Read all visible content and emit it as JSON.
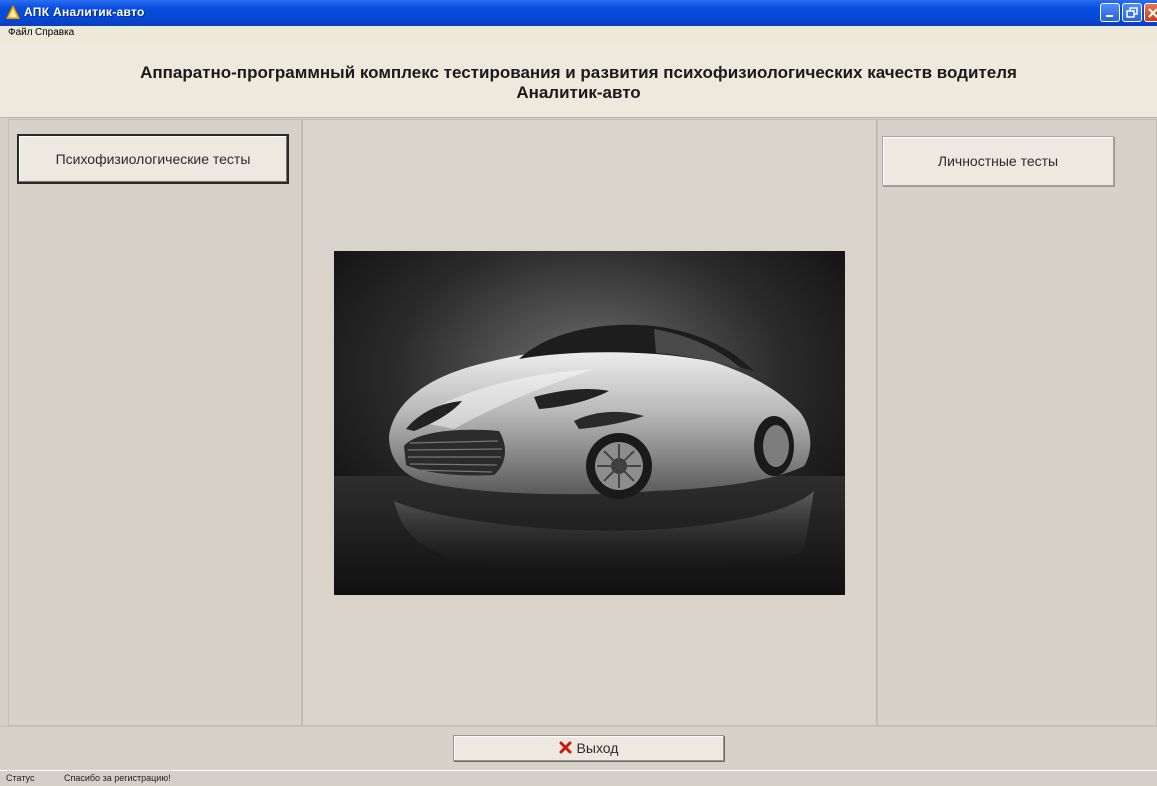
{
  "window": {
    "title": "АПК Аналитик-авто"
  },
  "menu": {
    "items": [
      {
        "label": "Файл"
      },
      {
        "label": "Справка"
      }
    ]
  },
  "header": {
    "title_line1": "Аппаратно-программный комплекс тестирования и развития психофизиологических качеств водителя",
    "title_line2": "Аналитик-авто"
  },
  "left_panel": {
    "button_label": "Психофизиологические тесты"
  },
  "right_panel": {
    "button_label": "Личностные тесты"
  },
  "center_panel": {
    "image": "sports-car-photo"
  },
  "footer": {
    "exit_label": "Выход",
    "exit_icon": "red-x-icon"
  },
  "status": {
    "label": "Статус",
    "text": "Спасибо за регистрацию!"
  },
  "colors": {
    "titlebar": "#0a4ee0",
    "background": "#d4d0c8",
    "exit_icon": "#cc1a0f"
  }
}
